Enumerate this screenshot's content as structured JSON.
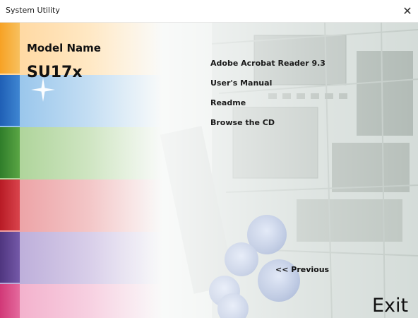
{
  "window": {
    "title": "System Utility",
    "close_glyph": "✕"
  },
  "model": {
    "label": "Model Name",
    "value": "SU17x"
  },
  "menu": {
    "items": [
      {
        "label": "Adobe Acrobat Reader 9.3"
      },
      {
        "label": "User's Manual"
      },
      {
        "label": "Readme"
      },
      {
        "label": "Browse the CD"
      }
    ]
  },
  "nav": {
    "previous_label": "<< Previous",
    "exit_label": "Exit"
  },
  "colors": {
    "tab_orange": "#f39a1e",
    "tab_blue": "#1f5fb5",
    "tab_green": "#3a8a2e",
    "tab_red": "#c8202b",
    "tab_purple": "#5a3a8a",
    "tab_pink": "#d8407a"
  }
}
